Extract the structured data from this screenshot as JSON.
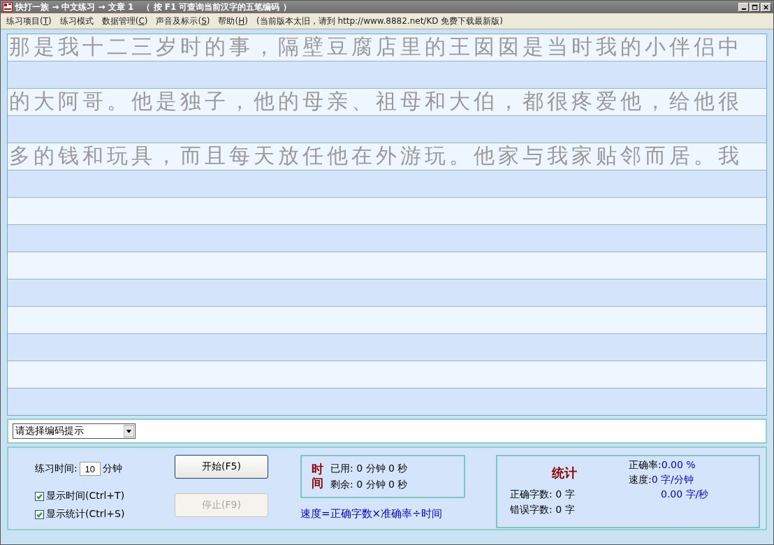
{
  "window": {
    "title": "快打一族 → 中文练习 → 文章 1　（ 按 F1 可查询当前汉字的五笔编码 ）"
  },
  "menu": [
    {
      "label": "练习项目(T)"
    },
    {
      "label": "练习模式"
    },
    {
      "label": "数据管理(C)"
    },
    {
      "label": "声音及标示(S)"
    },
    {
      "label": "帮助(H)"
    },
    {
      "label": "(当前版本太旧，请到 http://www.8882.net/KD 免费下载最新版)"
    }
  ],
  "lines": [
    "那是我十二三岁时的事，隔壁豆腐店里的王囡囡是当时我的小伴侣中",
    "的大阿哥。他是独子，他的母亲、祖母和大伯，都很疼爱他，给他很",
    "多的钱和玩具，而且每天放任他在外游玩。他家与我家贴邻而居。我"
  ],
  "code_hint": {
    "value": "请选择编码提示"
  },
  "practice_time": {
    "label": "练习时间:",
    "value": "10",
    "unit": "分钟"
  },
  "options": [
    {
      "label": "显示时间(Ctrl+T)",
      "checked": true
    },
    {
      "label": "显示统计(Ctrl+S)",
      "checked": true
    }
  ],
  "buttons": [
    {
      "label": "开始(F5)",
      "disabled": false
    },
    {
      "label": "停止(F9)",
      "disabled": true
    }
  ],
  "time": {
    "title": "时间",
    "rows": [
      "已用: 0 分钟 0 秒",
      "剩余: 0 分钟 0 秒"
    ],
    "formula": "速度=正确字数×准确率÷时间"
  },
  "stats": {
    "title": "统计",
    "correct": "正确字数: 0 字",
    "wrong": "错误字数: 0 字",
    "accuracy_label": "正确率:",
    "accuracy": "0.00 %",
    "speed_label": "速度:",
    "speed_min": "0 字/分钟",
    "speed_sec": "0.00 字/秒"
  }
}
